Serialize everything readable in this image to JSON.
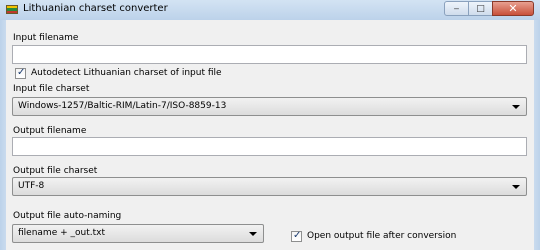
{
  "window": {
    "title": "Lithuanian charset converter",
    "flag_colors": [
      "#f2c200",
      "#2a8a3a",
      "#c0392b"
    ],
    "controls": {
      "minimize": "‒",
      "maximize": "□",
      "close": "✕"
    }
  },
  "form": {
    "input_filename": {
      "label": "Input filename",
      "value": "",
      "placeholder": ""
    },
    "autodetect": {
      "label": "Autodetect Lithuanian charset of input file",
      "checked": true
    },
    "input_charset": {
      "label": "Input file charset",
      "selected": "Windows-1257/Baltic-RIM/Latin-7/ISO-8859-13"
    },
    "output_filename": {
      "label": "Output filename",
      "value": "",
      "placeholder": ""
    },
    "output_charset": {
      "label": "Output file charset",
      "selected": "UTF-8"
    },
    "auto_naming": {
      "label": "Output file auto-naming",
      "selected": "filename + _out.txt"
    },
    "open_after": {
      "label": "Open output file after conversion",
      "checked": true
    }
  },
  "icons": {
    "app": "lithuanian-flag-icon",
    "check": "✓",
    "dropdown": "chevron-down-icon"
  }
}
